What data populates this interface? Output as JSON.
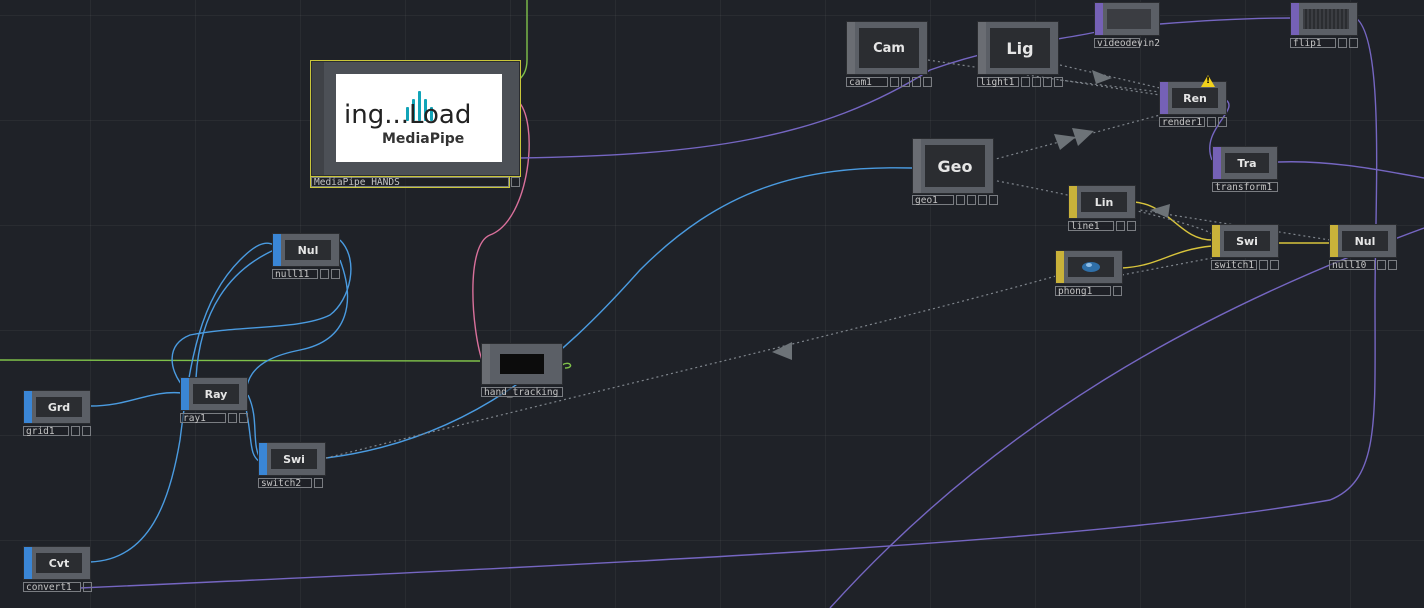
{
  "nodes": {
    "cam": {
      "face": "Cam",
      "label": "cam1"
    },
    "lig": {
      "face": "Lig",
      "label": "light1"
    },
    "videodevin": {
      "label": "videodevin2"
    },
    "flip": {
      "label": "flip1"
    },
    "ren": {
      "face": "Ren",
      "label": "render1"
    },
    "geo": {
      "face": "Geo",
      "label": "geo1"
    },
    "tra": {
      "face": "Tra",
      "label": "transform1"
    },
    "lin": {
      "face": "Lin",
      "label": "line1"
    },
    "swi1": {
      "face": "Swi",
      "label": "switch1"
    },
    "nul10": {
      "face": "Nul",
      "label": "null10"
    },
    "phong": {
      "label": "phong1"
    },
    "mediapipe": {
      "label": "MediaPipe_HANDS",
      "preview_text": "ing...Load",
      "preview_sub": "MediaPipe"
    },
    "hand": {
      "label": "hand_tracking"
    },
    "nul11": {
      "face": "Nul",
      "label": "null11"
    },
    "ray": {
      "face": "Ray",
      "label": "ray1"
    },
    "grd": {
      "face": "Grd",
      "label": "grid1"
    },
    "swi2": {
      "face": "Swi",
      "label": "switch2"
    },
    "cvt": {
      "face": "Cvt",
      "label": "convert1"
    }
  },
  "colors": {
    "background": "#1f2228",
    "wire_blue": "#4a9be0",
    "wire_purple": "#7566c2",
    "wire_green": "#7fc14a",
    "wire_pink": "#d9709b",
    "wire_yellow": "#d8c43c",
    "wire_dotted": "#7f858c",
    "warning": "#f2d21c"
  },
  "icons": {
    "warning": "warning-triangle-icon"
  }
}
